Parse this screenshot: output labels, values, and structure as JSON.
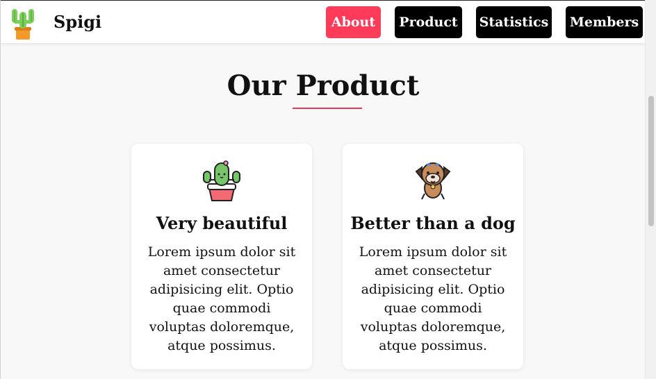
{
  "header": {
    "brand": "Spigi",
    "logo": "cactus-logo",
    "nav": [
      {
        "label": "About",
        "active": true
      },
      {
        "label": "Product",
        "active": false
      },
      {
        "label": "Statistics",
        "active": false
      },
      {
        "label": "Members",
        "active": false
      }
    ]
  },
  "main": {
    "section_title": "Our Product",
    "accent_color": "#ff3b5a",
    "cards": [
      {
        "icon": "cactus-icon",
        "title": "Very beautiful",
        "text": "Lorem ipsum dolor sit amet consectetur adipisicing elit. Optio quae commodi voluptas doloremque, atque possimus."
      },
      {
        "icon": "dog-icon",
        "title": "Better than a dog",
        "text": "Lorem ipsum dolor sit amet consectetur adipisicing elit. Optio quae commodi voluptas doloremque, atque possimus."
      }
    ]
  }
}
